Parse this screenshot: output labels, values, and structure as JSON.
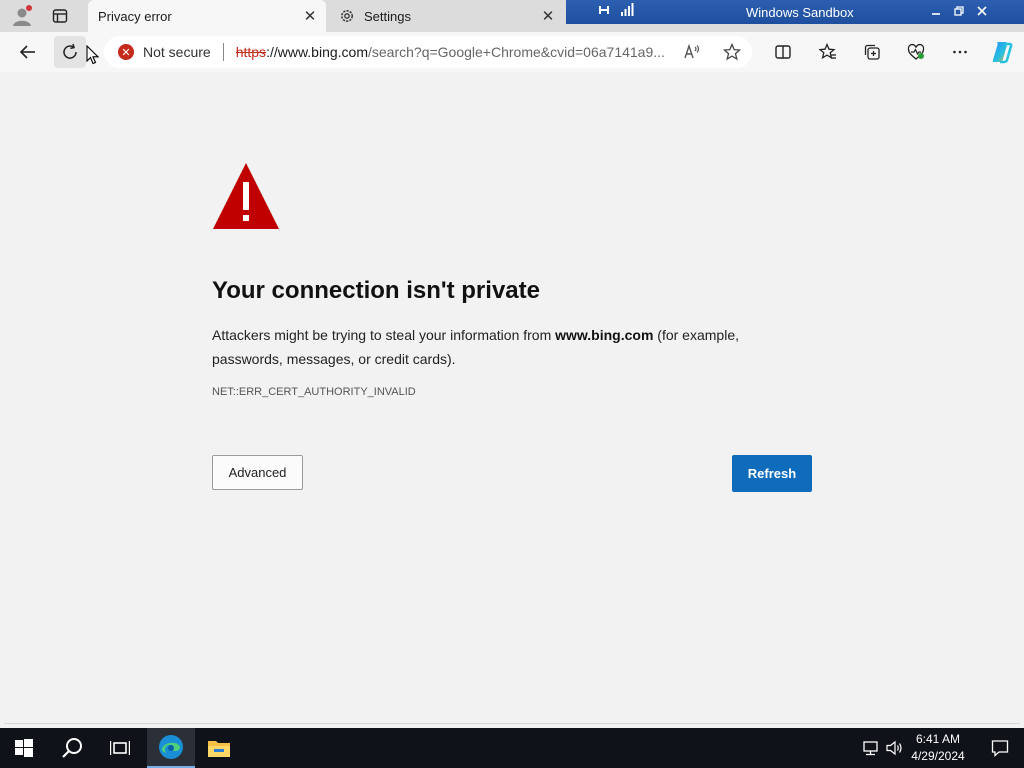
{
  "tabs": [
    {
      "title": "Privacy error",
      "active": true
    },
    {
      "title": "Settings",
      "active": false
    }
  ],
  "sandbox": {
    "title": "Windows Sandbox"
  },
  "address_bar": {
    "security_label": "Not secure",
    "url_scheme": "https",
    "url_host": "://www.bing.com",
    "url_rest": "/search?q=Google+Chrome&cvid=06a7141a9..."
  },
  "error_page": {
    "heading": "Your connection isn't private",
    "desc_before": "Attackers might be trying to steal your information from ",
    "desc_host": "www.bing.com",
    "desc_after": " (for example, passwords, messages, or credit cards).",
    "error_code": "NET::ERR_CERT_AUTHORITY_INVALID",
    "advanced_label": "Advanced",
    "refresh_label": "Refresh"
  },
  "taskbar": {
    "time": "6:41 AM",
    "date": "4/29/2024"
  },
  "colors": {
    "accent": "#0f6cbd",
    "warning": "#c42b1c",
    "taskbar": "#0f1218"
  },
  "icons": [
    "profile-icon",
    "tab-actions-icon",
    "settings-gear-icon",
    "back-icon",
    "refresh-icon",
    "read-aloud-icon",
    "favorite-star-icon",
    "split-screen-icon",
    "favorites-icon",
    "collections-icon",
    "browser-essentials-icon",
    "more-icon",
    "copilot-icon",
    "warning-triangle-icon",
    "start-icon",
    "search-icon",
    "task-view-icon",
    "edge-icon",
    "file-explorer-icon",
    "network-icon",
    "volume-icon",
    "notifications-icon"
  ]
}
